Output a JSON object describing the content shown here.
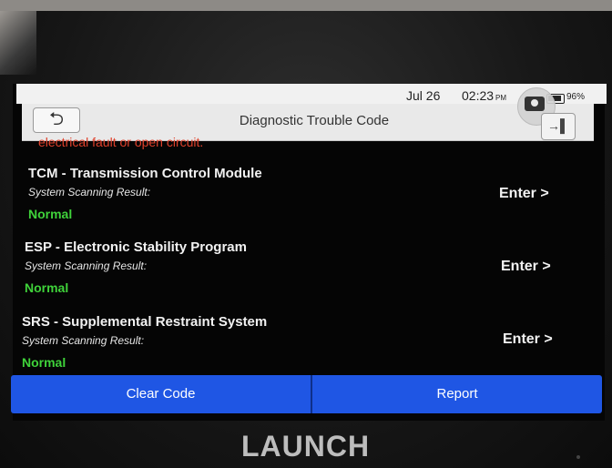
{
  "status_bar": {
    "date": "Jul 26",
    "time": "02:23",
    "ampm": "PM",
    "battery": "96%"
  },
  "header": {
    "title": "Diagnostic Trouble Code",
    "back_icon": "back-arrow-icon",
    "camera_icon": "camera-icon",
    "exit_icon": "exit-icon"
  },
  "fault_message": "electrical fault or open circuit.",
  "modules": [
    {
      "title": "TCM - Transmission Control Module",
      "subtitle": "System Scanning Result:",
      "status": "Normal",
      "action": "Enter >"
    },
    {
      "title": "ESP - Electronic Stability Program",
      "subtitle": "System Scanning Result:",
      "status": "Normal",
      "action": "Enter >"
    },
    {
      "title": "SRS - Supplemental Restraint System",
      "subtitle": "System Scanning Result:",
      "status": "Normal",
      "action": "Enter >"
    }
  ],
  "footer": {
    "clear_code": "Clear Code",
    "report": "Report"
  },
  "brand": "LAUNCH",
  "colors": {
    "accent_blue": "#1f56e4",
    "status_green": "#3fd23a",
    "fault_red": "#e0412c"
  }
}
